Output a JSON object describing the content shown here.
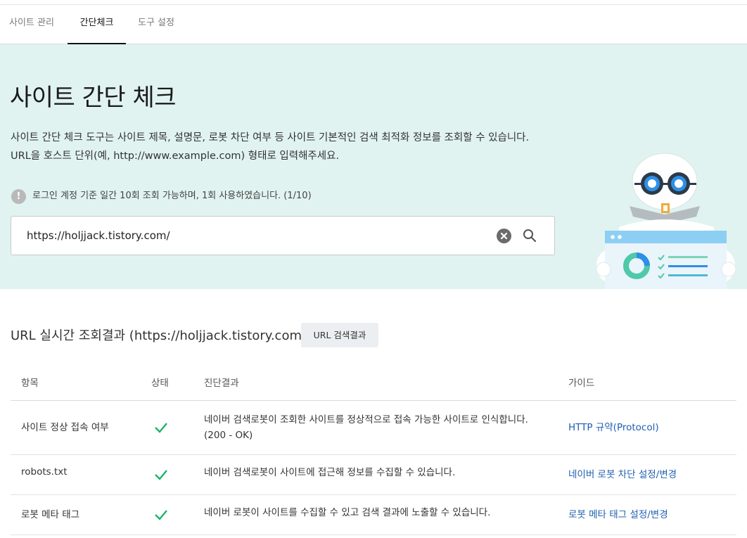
{
  "tabs": [
    {
      "label": "사이트 관리",
      "active": false
    },
    {
      "label": "간단체크",
      "active": true
    },
    {
      "label": "도구 설정",
      "active": false
    }
  ],
  "hero": {
    "title": "사이트 간단 체크",
    "desc_line1": "사이트 간단 체크 도구는 사이트 제목, 설명문, 로봇 차단 여부 등 사이트 기본적인 검색 최적화 정보를 조회할 수 있습니다.",
    "desc_line2": "URL을 호스트 단위(예, http://www.example.com) 형태로 입력해주세요.",
    "notice": "로그인 계정 기준 일간 10회 조회 가능하며, 1회 사용하였습니다. (1/10)",
    "notice_icon": "!",
    "background": "#e0f3f0"
  },
  "search": {
    "value": "https://holjjack.tistory.com/",
    "clear_icon": "clear-circle-icon",
    "search_icon": "magnifier-icon"
  },
  "result": {
    "title": "URL 실시간 조회결과 (https://holjjack.tistory.com/)",
    "button_label": "URL 검색결과"
  },
  "table": {
    "headers": {
      "item": "항목",
      "status": "상태",
      "diagnosis": "진단결과",
      "guide": "가이드"
    },
    "rows": [
      {
        "item": "사이트 정상 접속 여부",
        "status": "check-icon",
        "diagnosis_line1": "네이버 검색로봇이 조회한 사이트를 정상적으로 접속 가능한 사이트로 인식합니다.",
        "diagnosis_line2": "(200 - OK)",
        "guide": "HTTP 규약(Protocol)"
      },
      {
        "item": "robots.txt",
        "status": "check-icon",
        "diagnosis_line1": "네이버 검색로봇이 사이트에 접근해 정보를 수집할 수 있습니다.",
        "guide": "네이버 로봇 차단 설정/변경"
      },
      {
        "item": "로봇 메타 태그",
        "status": "check-icon",
        "diagnosis_line1": "네이버 로봇이 사이트를 수집할 수 있고 검색 결과에 노출할 수 있습니다.",
        "guide": "로봇 메타 태그 설정/변경"
      }
    ],
    "check_color": "#1cb36a",
    "link_color": "#1f5fb0"
  }
}
